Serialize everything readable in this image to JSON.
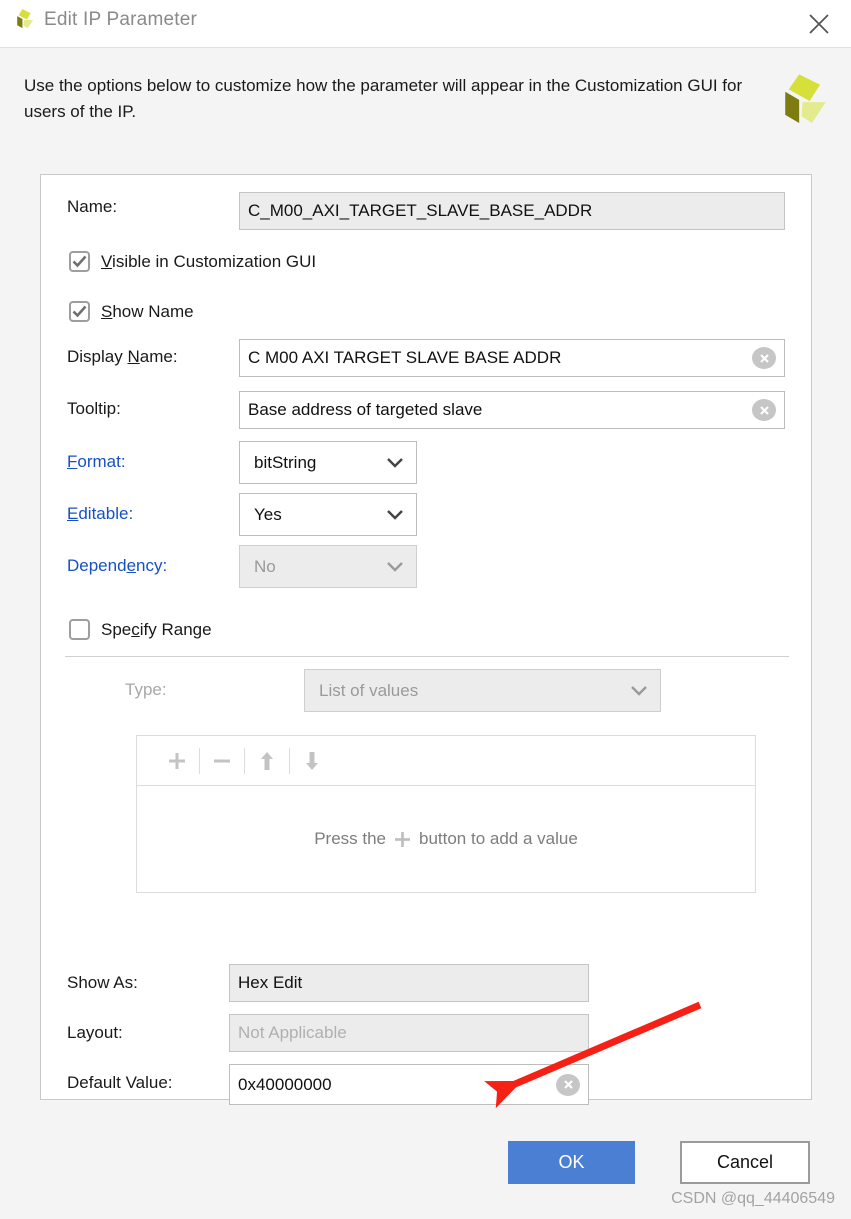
{
  "window": {
    "title": "Edit IP Parameter",
    "close_icon": "close-icon",
    "app_icon": "xilinx-logo-icon"
  },
  "header": {
    "description": "Use the options below to customize how the parameter will appear in the Customization GUI for users of the IP.",
    "logo_icon": "xilinx-logo-icon"
  },
  "form": {
    "name": {
      "label": "Name:",
      "value": "C_M00_AXI_TARGET_SLAVE_BASE_ADDR",
      "readonly": true
    },
    "visible_in_gui": {
      "label_pre": "V",
      "label_post": "isible in Customization GUI",
      "checked": true
    },
    "show_name": {
      "label_pre": "S",
      "label_post": "how Name",
      "checked": true
    },
    "display_name": {
      "label_pre": "Display ",
      "label_key": "N",
      "label_post": "ame:",
      "value": "C M00 AXI TARGET SLAVE BASE ADDR",
      "clear_icon": "clear-icon"
    },
    "tooltip": {
      "label": "Tooltip:",
      "value": "Base address of targeted slave",
      "clear_icon": "clear-icon"
    },
    "format": {
      "label_key": "F",
      "label_post": "ormat:",
      "value": "bitString",
      "disabled": false
    },
    "editable": {
      "label_key": "E",
      "label_post": "ditable:",
      "value": "Yes",
      "disabled": false
    },
    "dependency": {
      "label_pre": "Depend",
      "label_key": "e",
      "label_post": "ncy:",
      "value": "No",
      "disabled": true
    },
    "specify_range": {
      "label_pre": "Spe",
      "label_key": "c",
      "label_post": "ify Range",
      "checked": false
    },
    "range_type": {
      "label": "Type:",
      "value": "List of values",
      "disabled": true
    },
    "range_list": {
      "toolbar": [
        {
          "name": "add-value-button",
          "glyph": "+"
        },
        {
          "name": "remove-value-button",
          "glyph": "−"
        },
        {
          "name": "move-up-button",
          "glyph": "↑"
        },
        {
          "name": "move-down-button",
          "glyph": "↓"
        }
      ],
      "empty_text_before": "Press the",
      "empty_icon": "plus-icon",
      "empty_text_after": "button to add a value"
    },
    "show_as": {
      "label": "Show As:",
      "value": "Hex Edit",
      "readonly": true
    },
    "layout": {
      "label": "Layout:",
      "value": "Not Applicable",
      "readonly": true,
      "dimmed": true
    },
    "default_value": {
      "label": "Default Value:",
      "value": "0x40000000",
      "clear_icon": "clear-icon"
    }
  },
  "footer": {
    "ok_label": "OK",
    "cancel_label": "Cancel"
  },
  "watermark": "CSDN @qq_44406549",
  "colors": {
    "accent_button": "#4a7fd4",
    "link": "#1751c4",
    "logo_dark": "#7d7c11",
    "logo_mid": "#d7e03a",
    "logo_light": "#e3eb8e",
    "annotation_arrow": "#f62116"
  }
}
